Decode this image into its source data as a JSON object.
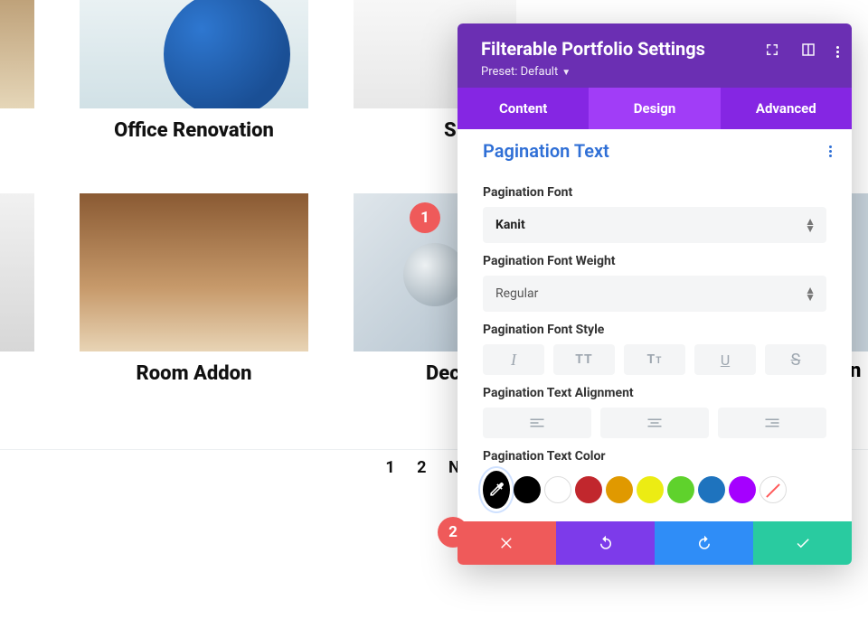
{
  "portfolio": {
    "row1": {
      "item1_caption": "Office Renovation",
      "item2_caption_partial": "S"
    },
    "row2": {
      "item1_caption": "Room Addon",
      "item2_caption_partial": "Dec",
      "right_edge_caption_partial": "n"
    }
  },
  "pagination": {
    "page1": "1",
    "page2": "2",
    "next": "Next"
  },
  "callouts": {
    "one": "1",
    "two": "2"
  },
  "panel": {
    "title": "Filterable Portfolio Settings",
    "preset_label": "Preset: Default",
    "tabs": {
      "content": "Content",
      "design": "Design",
      "advanced": "Advanced"
    },
    "section_title": "Pagination Text",
    "font": {
      "label": "Pagination Font",
      "value": "Kanit"
    },
    "weight": {
      "label": "Pagination Font Weight",
      "value": "Regular"
    },
    "style": {
      "label": "Pagination Font Style"
    },
    "align": {
      "label": "Pagination Text Alignment"
    },
    "color": {
      "label": "Pagination Text Color",
      "swatches": [
        "#000000",
        "#ffffff",
        "#c1272d",
        "#e09900",
        "#ecec13",
        "#5fd22c",
        "#1e73be",
        "#a500ff"
      ]
    }
  }
}
